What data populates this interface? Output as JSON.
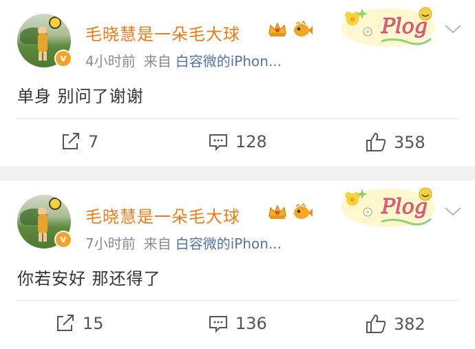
{
  "posts": [
    {
      "username": "毛晓慧是一朵毛大球",
      "time": "4小时前",
      "source_prefix": "来自",
      "source": "白容微的iPhon...",
      "content": "单身 别问了谢谢",
      "reposts": "7",
      "comments": "128",
      "likes": "358"
    },
    {
      "username": "毛晓慧是一朵毛大球",
      "time": "7小时前",
      "source_prefix": "来自",
      "source": "白容微的iPhon...",
      "content": "你若安好 那还得了",
      "reposts": "15",
      "comments": "136",
      "likes": "382"
    }
  ],
  "badge": {
    "verify_symbol": "v",
    "plog_text": "Plog"
  },
  "colors": {
    "username": "#ef7b16",
    "source": "#4f74a8",
    "meta": "#8b8b8b",
    "verify": "#f7a227"
  },
  "icons": [
    "repost-icon",
    "comment-icon",
    "like-icon",
    "chevron-down-icon",
    "crown-icon",
    "fish-icon",
    "plog-sticker-icon"
  ]
}
